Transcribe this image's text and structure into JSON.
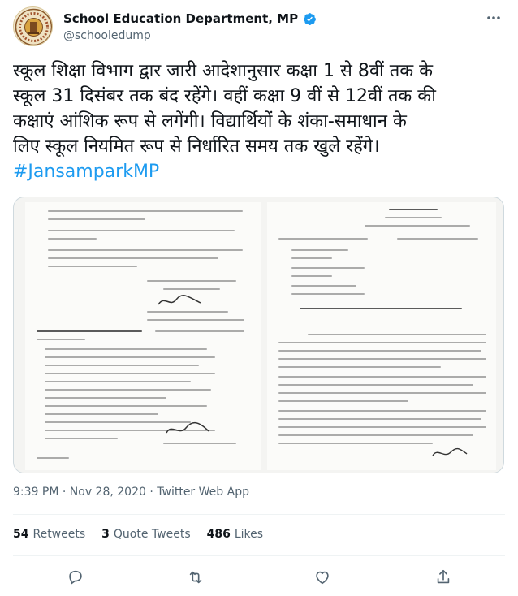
{
  "account": {
    "name": "School Education Department, MP",
    "handle": "@schooledump"
  },
  "tweet": {
    "lines": [
      "स्कूल शिक्षा विभाग द्वार जारी आदेशानुसार कक्षा 1 से 8वीं तक के",
      "स्कूल 31 दिसंबर तक बंद रहेंगे। वहीं कक्षा 9 वीं से 12वीं तक की",
      "कक्षाएं आंशिक रूप से लगेंगी। विद्यार्थियों के शंका-समाधान के",
      "लिए स्कूल नियमित रूप से निर्धारित समय तक खुले रहेंगे।"
    ],
    "hashtag": "#JansamparkMP"
  },
  "meta": {
    "time": "9:39 PM",
    "separator": "·",
    "date": "Nov 28, 2020",
    "source": "Twitter Web App"
  },
  "stats": {
    "retweets_count": "54",
    "retweets_label": "Retweets",
    "quotes_count": "3",
    "quotes_label": "Quote Tweets",
    "likes_count": "486",
    "likes_label": "Likes"
  },
  "icons": {
    "verified": "verified-badge-icon",
    "more": "more-options-icon",
    "reply": "reply-icon",
    "retweet": "retweet-icon",
    "like": "like-icon",
    "share": "share-icon"
  },
  "colors": {
    "accent": "#1d9bf0",
    "text": "#0f1419",
    "secondary": "#536471",
    "border": "#cfd9de"
  }
}
